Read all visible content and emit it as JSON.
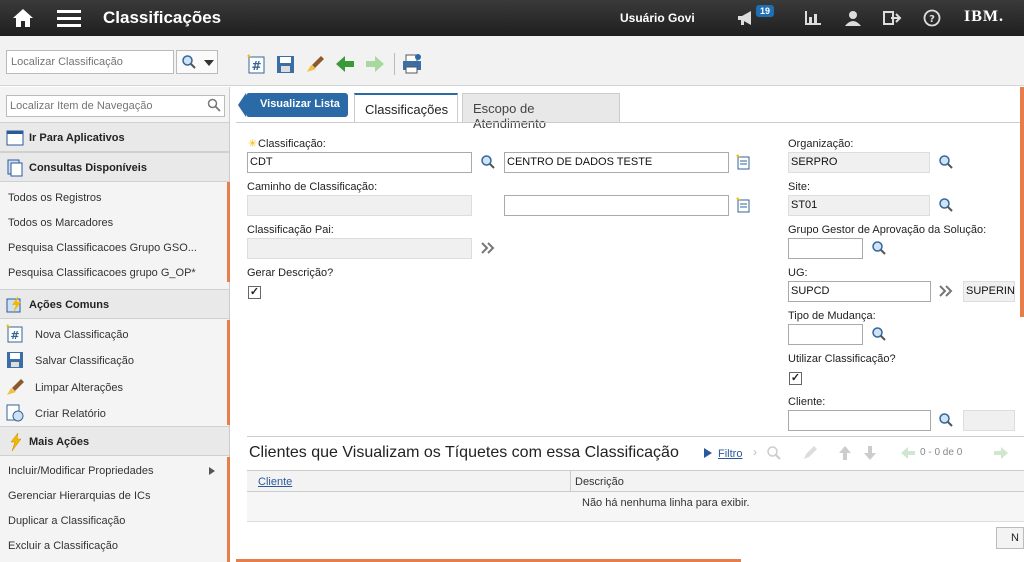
{
  "header": {
    "title": "Classificações",
    "user": "Usuário Govi",
    "notification_count": "19",
    "brand": "IBM."
  },
  "toolbar": {
    "search_placeholder": "Localizar Classificação"
  },
  "sidebar": {
    "nav_search_placeholder": "Localizar Item de Navegação",
    "go_to_apps": "Ir Para Aplicativos",
    "queries_header": "Consultas Disponíveis",
    "queries": [
      "Todos os Registros",
      "Todos os Marcadores",
      "Pesquisa Classificacoes Grupo GSO...",
      "Pesquisa Classificacoes grupo G_OP*"
    ],
    "common_actions_header": "Ações Comuns",
    "common_actions": [
      "Nova Classificação",
      "Salvar Classificação",
      "Limpar Alterações",
      "Criar Relatório"
    ],
    "more_actions_header": "Mais Ações",
    "more_actions": [
      "Incluir/Modificar Propriedades",
      "Gerenciar Hierarquias de ICs",
      "Duplicar a Classificação",
      "Excluir a Classificação"
    ]
  },
  "main": {
    "view_list": "Visualizar Lista",
    "tabs": [
      "Classificações",
      "Escopo de Atendimento"
    ],
    "form": {
      "classification_label": "Classificação:",
      "classification_value": "CDT",
      "classification_desc": "CENTRO DE DADOS TESTE",
      "path_label": "Caminho de Classificação:",
      "parent_label": "Classificação Pai:",
      "gen_desc_label": "Gerar Descrição?",
      "org_label": "Organização:",
      "org_value": "SERPRO",
      "site_label": "Site:",
      "site_value": "ST01",
      "approval_group_label": "Grupo Gestor de Aprovação da Solução:",
      "ug_label": "UG:",
      "ug_value": "SUPCD",
      "ug_desc": "SUPERINT",
      "change_type_label": "Tipo de Mudança:",
      "use_classification_label": "Utilizar Classificação?",
      "client_label": "Cliente:"
    },
    "clients_section": {
      "title": "Clientes que Visualizam os Tíquetes com essa Classificação",
      "filter": "Filtro",
      "pagination": "0 - 0 de 0",
      "columns": [
        "Cliente",
        "Descrição"
      ],
      "empty_message": "Não há nenhuma linha para exibir.",
      "new_row": "N"
    }
  }
}
